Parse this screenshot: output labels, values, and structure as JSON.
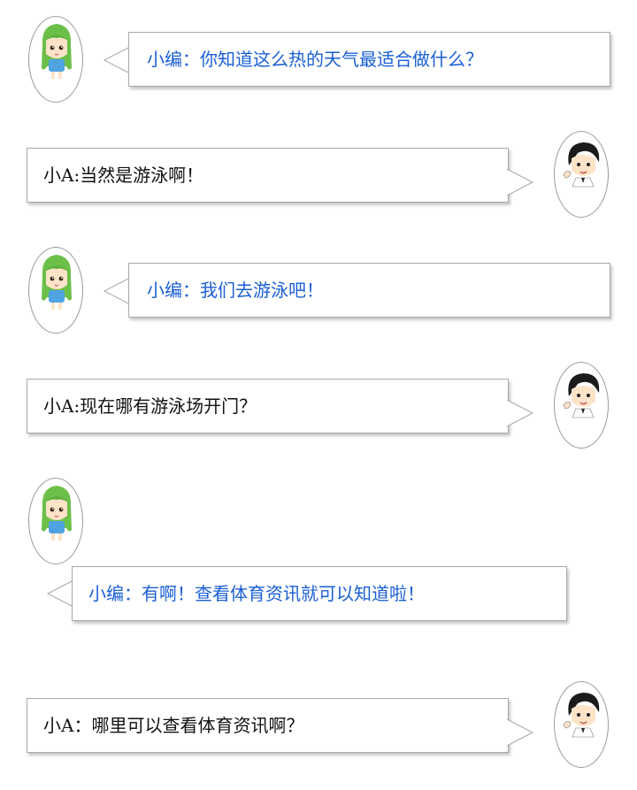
{
  "colors": {
    "editor_text": "#1a5fd6",
    "user_text": "#111111",
    "border": "#a9a9a9",
    "girl_hair": "#6cc04a",
    "boy_hair": "#1b1b1b"
  },
  "chat": [
    {
      "speaker": "editor",
      "icon": "green-hair-girl-avatar-icon",
      "text": "小编：你知道这么热的天气最适合做什么？"
    },
    {
      "speaker": "user",
      "icon": "black-hair-boy-avatar-icon",
      "text": "小A:当然是游泳啊！"
    },
    {
      "speaker": "editor",
      "icon": "green-hair-girl-avatar-icon",
      "text": "小编：我们去游泳吧！"
    },
    {
      "speaker": "user",
      "icon": "black-hair-boy-avatar-icon",
      "text": "小A:现在哪有游泳场开门？"
    },
    {
      "speaker": "editor",
      "icon": "green-hair-girl-avatar-icon",
      "text": "小编：有啊！查看体育资讯就可以知道啦！"
    },
    {
      "speaker": "user",
      "icon": "black-hair-boy-avatar-icon",
      "text": "小A：哪里可以查看体育资讯啊？"
    }
  ]
}
